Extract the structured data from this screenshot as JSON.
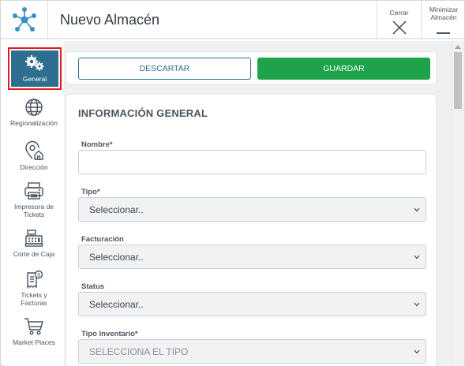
{
  "window": {
    "title": "Nuevo Almacén",
    "close_label": "Cerrar",
    "minimize_label": "Minimizar Almacén"
  },
  "sidebar": {
    "items": [
      {
        "label": "General",
        "icon": "gears-icon",
        "active": true
      },
      {
        "label": "Regionalización",
        "icon": "globe-icon"
      },
      {
        "label": "Dirección",
        "icon": "location-home-icon"
      },
      {
        "label": "Impresora de Tickets",
        "icon": "printer-icon"
      },
      {
        "label": "Corte de Caja",
        "icon": "cash-register-icon"
      },
      {
        "label": "Tickets y Facturas",
        "icon": "receipt-icon"
      },
      {
        "label": "Market Places",
        "icon": "shopping-cart-icon"
      }
    ]
  },
  "toolbar": {
    "discard_label": "DESCARTAR",
    "save_label": "GUARDAR"
  },
  "form": {
    "section_title": "INFORMACIÓN GENERAL",
    "fields": [
      {
        "label": "Nombre*",
        "type": "text",
        "value": ""
      },
      {
        "label": "Tipo*",
        "type": "select",
        "value": "Seleccionar.."
      },
      {
        "label": "Facturación",
        "type": "select",
        "value": "Seleccionar.."
      },
      {
        "label": "Status",
        "type": "select",
        "value": "Seleccionar.."
      },
      {
        "label": "Tipo Inventario*",
        "type": "select",
        "value": "SELECCIONA EL TIPO"
      }
    ]
  },
  "colors": {
    "primary": "#2e6e8e",
    "save": "#1fa34a",
    "highlight": "#e11b1b"
  }
}
